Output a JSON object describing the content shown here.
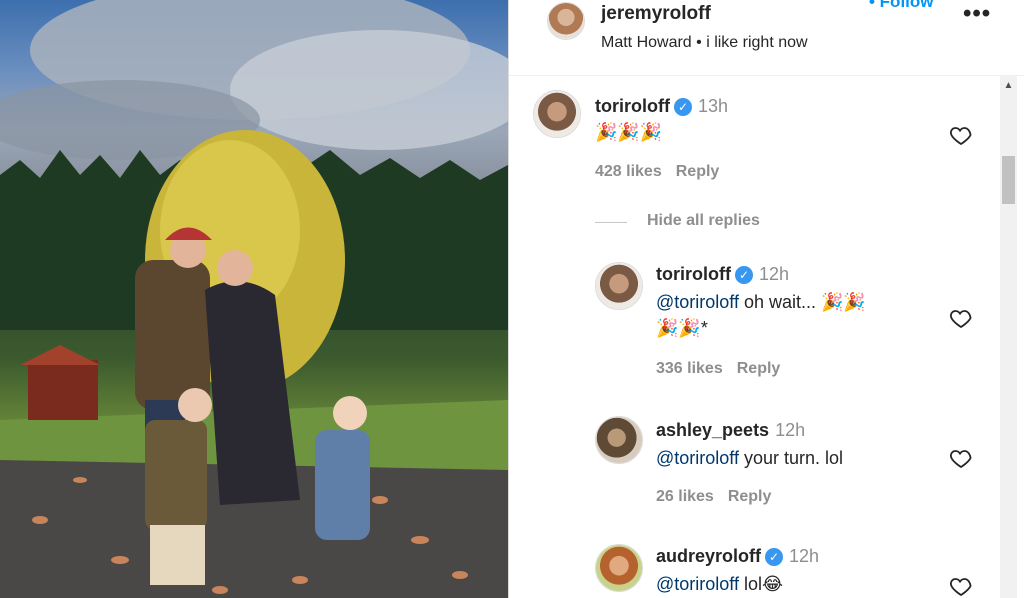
{
  "header": {
    "username": "jeremyroloff",
    "follow_label": "• Follow",
    "more_label": "•••",
    "subtitle": "Matt Howard • i like right now"
  },
  "comments": [
    {
      "username": "toriroloff",
      "verified": true,
      "time": "13h",
      "text_emoji": "🎉🎉🎉",
      "likes": "428 likes",
      "reply_label": "Reply"
    },
    {
      "username": "toriroloff",
      "verified": true,
      "time": "12h",
      "mention": "@toriroloff",
      "text": " oh wait... ",
      "text_emoji_1": "🎉🎉",
      "text_emoji_2": "🎉🎉",
      "text_suffix": "*",
      "likes": "336 likes",
      "reply_label": "Reply"
    },
    {
      "username": "ashley_peets",
      "verified": false,
      "time": "12h",
      "mention": "@toriroloff",
      "text": " your turn. lol",
      "likes": "26 likes",
      "reply_label": "Reply"
    },
    {
      "username": "audreyroloff",
      "verified": true,
      "time": "12h",
      "mention": "@toriroloff",
      "text": " lol😂"
    }
  ],
  "hide_replies_label": "Hide all replies",
  "icons": {
    "verified": "✓",
    "heart": "heart-icon",
    "scroll_up": "▲"
  }
}
